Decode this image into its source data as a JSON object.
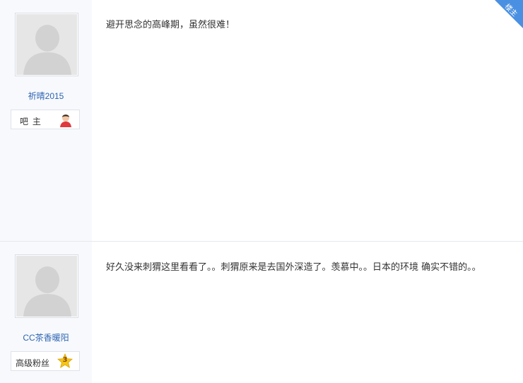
{
  "posts": [
    {
      "user": {
        "name": "祈晴2015",
        "badge_label": "吧 主",
        "avatar_icon": "default-avatar-icon",
        "badge_icon": "bazhu-avatar-icon"
      },
      "floor_tag": "楼主",
      "content": "避开思念的高峰期，虽然很难！"
    },
    {
      "user": {
        "name": "CC茶香暖阳",
        "badge_label": "高级粉丝",
        "level": "3",
        "avatar_icon": "default-avatar-icon",
        "badge_icon": "level-star-icon"
      },
      "content": "好久没来刺猬这里看看了。。刺猬原来是去国外深造了。羡慕中。。日本的环境 确实不错的。。"
    }
  ],
  "colors": {
    "link": "#2d64b3",
    "floor_tag": "#4a90e2",
    "sidebar_bg": "#f7f9fc",
    "star": "#f5c518"
  }
}
